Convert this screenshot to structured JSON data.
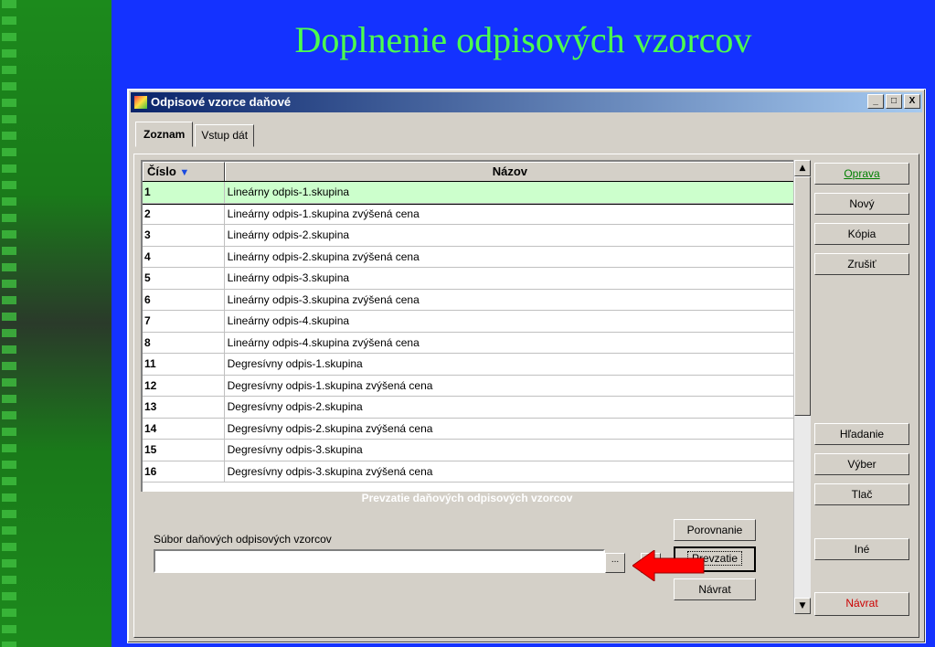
{
  "slide_title": "Doplnenie odpisových vzorcov",
  "window": {
    "title": "Odpisové vzorce daňové",
    "controls": {
      "minimize": "_",
      "maximize": "□",
      "close": "X"
    }
  },
  "tabs": [
    {
      "label": "Zoznam",
      "active": true
    },
    {
      "label": "Vstup dát",
      "active": false
    }
  ],
  "table": {
    "headers": {
      "number": "Číslo",
      "sort_icon": "▼",
      "name": "Názov"
    },
    "rows": [
      {
        "cislo": "1",
        "nazov": "Lineárny odpis-1.skupina"
      },
      {
        "cislo": "2",
        "nazov": "Lineárny odpis-1.skupina zvýšená cena"
      },
      {
        "cislo": "3",
        "nazov": "Lineárny odpis-2.skupina"
      },
      {
        "cislo": "4",
        "nazov": "Lineárny odpis-2.skupina zvýšená cena"
      },
      {
        "cislo": "5",
        "nazov": "Lineárny odpis-3.skupina"
      },
      {
        "cislo": "6",
        "nazov": "Lineárny odpis-3.skupina zvýšená cena"
      },
      {
        "cislo": "7",
        "nazov": "Lineárny odpis-4.skupina"
      },
      {
        "cislo": "8",
        "nazov": "Lineárny odpis-4.skupina zvýšená cena"
      },
      {
        "cislo": "11",
        "nazov": "Degresívny odpis-1.skupina"
      },
      {
        "cislo": "12",
        "nazov": "Degresívny odpis-1.skupina zvýšená cena"
      },
      {
        "cislo": "13",
        "nazov": "Degresívny odpis-2.skupina"
      },
      {
        "cislo": "14",
        "nazov": "Degresívny odpis-2.skupina zvýšená cena"
      },
      {
        "cislo": "15",
        "nazov": "Degresívny odpis-3.skupina"
      },
      {
        "cislo": "16",
        "nazov": "Degresívny odpis-3.skupina zvýšená cena"
      }
    ]
  },
  "import_panel": {
    "title": "Prevzatie daňových odpisových vzorcov",
    "file_label": "Súbor daňových odpisových vzorcov",
    "file_value": "",
    "browse_label": "...",
    "compare_label": "Porovnanie",
    "import_label": "Prevzatie",
    "back_label": "Návrat"
  },
  "side_buttons": {
    "oprava": "Oprava",
    "novy": "Nový",
    "kopia": "Kópia",
    "zrusit": "Zrušiť",
    "hladanie": "Hľadanie",
    "vyber": "Výber",
    "tlac": "Tlač",
    "ine": "Iné",
    "navrat": "Návrat"
  },
  "colors": {
    "selected_row": "#ccffcc",
    "accent_green": "#4dff4d",
    "arrow_red": "#ff0000",
    "return_red": "#cc0000"
  }
}
